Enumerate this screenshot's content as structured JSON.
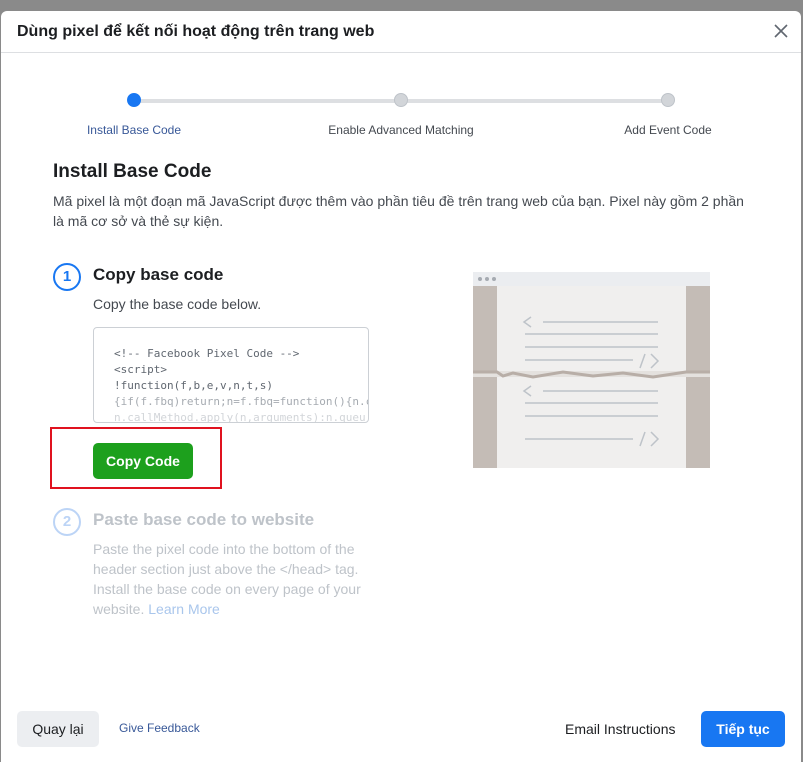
{
  "dialog": {
    "title": "Dùng pixel để kết nối hoạt động trên trang web",
    "close_icon": "close-icon"
  },
  "stepper": {
    "steps": [
      {
        "label": "Install Base Code",
        "active": true
      },
      {
        "label": "Enable Advanced Matching",
        "active": false
      },
      {
        "label": "Add Event Code",
        "active": false
      }
    ]
  },
  "section": {
    "title": "Install Base Code",
    "description": "Mã pixel là một đoạn mã JavaScript được thêm vào phần tiêu đề trên trang web của bạn. Pixel này gồm 2 phần là mã cơ sở và thẻ sự kiện."
  },
  "step1": {
    "number": "1",
    "title": "Copy base code",
    "description": "Copy the base code below.",
    "code_lines": [
      "<!-- Facebook Pixel Code -->",
      "<script>",
      "!function(f,b,e,v,n,t,s)",
      "{if(f.fbq)return;n=f.fbq=function(){n.ca",
      "n.callMethod.apply(n,arguments):n.queu"
    ],
    "copy_button": "Copy Code"
  },
  "step2": {
    "number": "2",
    "title": "Paste base code to website",
    "description": "Paste the pixel code into the bottom of the header section just above the </head> tag. Install the base code on every page of your website.",
    "learn_more": "Learn More"
  },
  "footer": {
    "back": "Quay lại",
    "feedback": "Give Feedback",
    "email": "Email Instructions",
    "next": "Tiếp tục"
  },
  "colors": {
    "primary": "#1877f2",
    "copy_button": "#1da01d",
    "highlight": "#e0121f"
  }
}
